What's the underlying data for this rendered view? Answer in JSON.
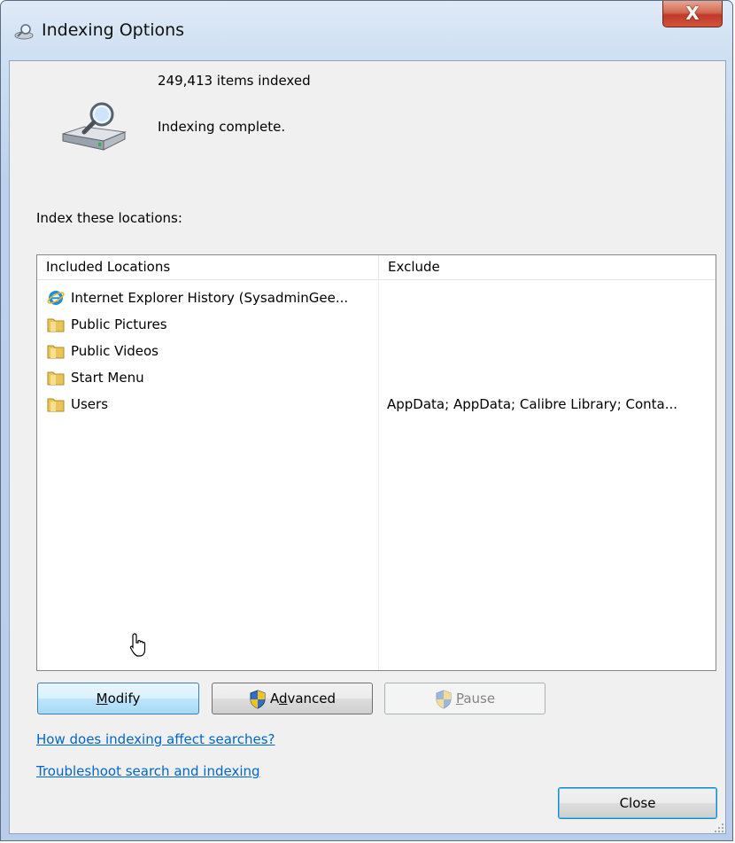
{
  "window": {
    "title": "Indexing Options",
    "close_glyph": "X"
  },
  "status": {
    "items_indexed": "249,413 items indexed",
    "state": "Indexing complete."
  },
  "locations": {
    "label": "Index these locations:",
    "columns": {
      "included": "Included Locations",
      "exclude": "Exclude"
    },
    "rows": [
      {
        "icon": "internet-explorer-icon",
        "name": "Internet Explorer History (SysadminGee...",
        "exclude": ""
      },
      {
        "icon": "folder-icon",
        "name": "Public Pictures",
        "exclude": ""
      },
      {
        "icon": "folder-icon",
        "name": "Public Videos",
        "exclude": ""
      },
      {
        "icon": "folder-icon",
        "name": "Start Menu",
        "exclude": ""
      },
      {
        "icon": "folder-icon",
        "name": "Users",
        "exclude": "AppData; AppData; Calibre Library; Conta..."
      }
    ]
  },
  "buttons": {
    "modify": {
      "accel": "M",
      "rest": "odify"
    },
    "advanced": {
      "pre": "A",
      "accel": "d",
      "rest": "vanced"
    },
    "pause": {
      "accel": "P",
      "rest": "ause",
      "enabled": false
    },
    "close": "Close"
  },
  "links": {
    "how": "How does indexing affect searches?",
    "troubleshoot": "Troubleshoot search and indexing"
  },
  "colors": {
    "link": "#0066cc",
    "accent": "#3c7fb1",
    "close_button": "#c0392b"
  }
}
